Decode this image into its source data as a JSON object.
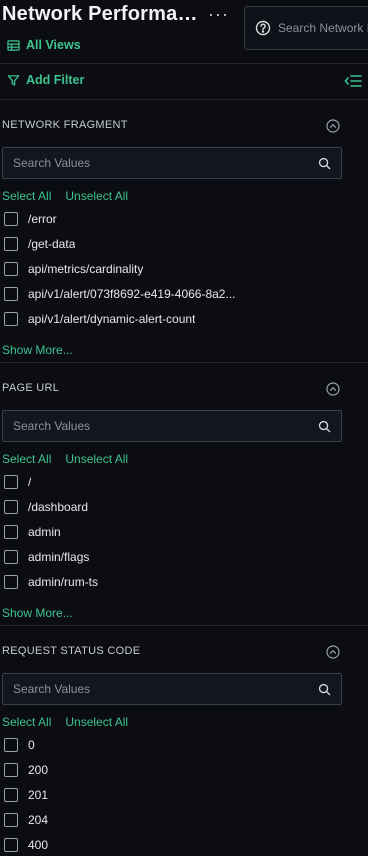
{
  "header": {
    "title": "Network Performan...",
    "more_label": "···",
    "all_views_label": "All Views",
    "search_placeholder": "Search Network Performance"
  },
  "filter_bar": {
    "add_filter_label": "Add Filter"
  },
  "sections": [
    {
      "title": "NETWORK FRAGMENT",
      "search_placeholder": "Search Values",
      "select_all": "Select All",
      "unselect_all": "Unselect All",
      "items": [
        "/error",
        "/get-data",
        "api/metrics/cardinality",
        "api/v1/alert/073f8692-e419-4066-8a2...",
        "api/v1/alert/dynamic-alert-count"
      ],
      "show_more": "Show More..."
    },
    {
      "title": "PAGE URL",
      "search_placeholder": "Search Values",
      "select_all": "Select All",
      "unselect_all": "Unselect All",
      "items": [
        "/",
        "/dashboard",
        "admin",
        "admin/flags",
        "admin/rum-ts"
      ],
      "show_more": "Show More..."
    },
    {
      "title": "REQUEST STATUS CODE",
      "search_placeholder": "Search Values",
      "select_all": "Select All",
      "unselect_all": "Unselect All",
      "items": [
        "0",
        "200",
        "201",
        "204",
        "400"
      ]
    }
  ],
  "colors": {
    "background": "#0b0d12",
    "accent": "#3ec38f",
    "border": "#232730",
    "text": "#e6e8ec"
  },
  "icons": {
    "more": "more-dots-icon",
    "views": "table-icon",
    "search_help": "question-circle-icon",
    "filter": "filter-icon",
    "collapse": "collapse-list-icon",
    "chevron": "chevron-up-icon",
    "search": "search-icon"
  }
}
